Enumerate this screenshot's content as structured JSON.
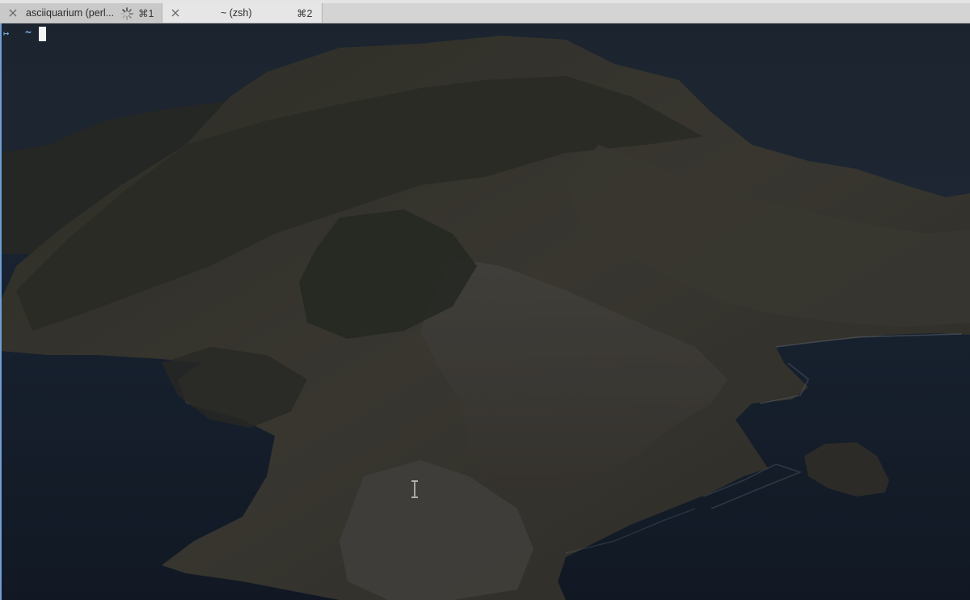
{
  "tabs": [
    {
      "title": "asciiquarium (perl...",
      "shortcut": "⌘1",
      "busy": true,
      "active": false
    },
    {
      "title": "~ (zsh)",
      "shortcut": "⌘2",
      "busy": false,
      "active": true
    }
  ],
  "terminal": {
    "prompt_arrow": "↦",
    "prompt_dir": "~",
    "cursor": "block"
  },
  "theme": {
    "prompt_color": "#7fb2e5",
    "tabbar_bg": "#d4d4d4",
    "active_tab_bg": "#e6e6e6",
    "sea_color": "#1c2838",
    "sky_color": "#26323f"
  },
  "icons": [
    "close-icon",
    "spinner-icon",
    "text-cursor-icon"
  ]
}
